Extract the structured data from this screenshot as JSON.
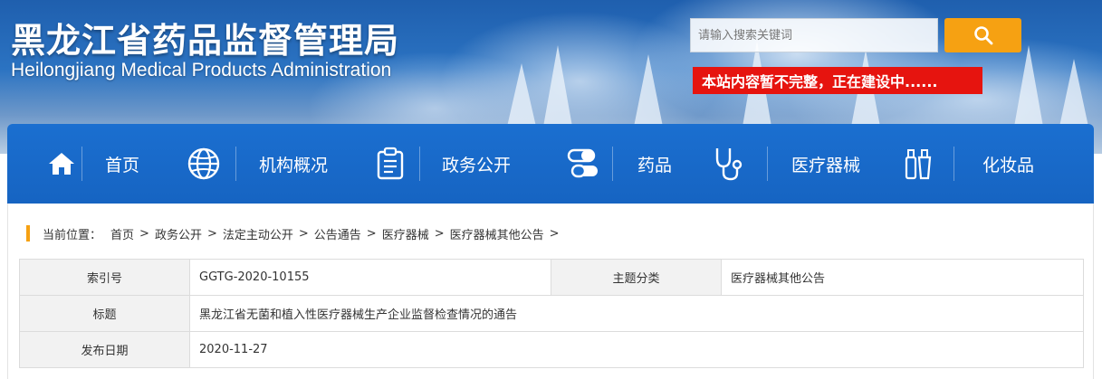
{
  "header": {
    "title": "黑龙江省药品监督管理局",
    "subtitle": "Heilongjiang Medical Products Administration",
    "search_placeholder": "请输入搜索关键词",
    "notice": "本站内容暂不完整，正在建设中......"
  },
  "nav": {
    "items": [
      {
        "label": "首页",
        "icon": "home-icon"
      },
      {
        "label": "机构概况",
        "icon": "globe-icon"
      },
      {
        "label": "政务公开",
        "icon": "clipboard-icon"
      },
      {
        "label": "药品",
        "icon": "pill-icon"
      },
      {
        "label": "医疗器械",
        "icon": "stethoscope-icon"
      },
      {
        "label": "化妆品",
        "icon": "cosmetics-icon"
      }
    ]
  },
  "breadcrumb": {
    "prefix": "当前位置：",
    "items": [
      "首页",
      "政务公开",
      "法定主动公开",
      "公告通告",
      "医疗器械",
      "医疗器械其他公告"
    ],
    "separator": ">"
  },
  "meta": {
    "index_label": "索引号",
    "index_value": "GGTG-2020-10155",
    "category_label": "主题分类",
    "category_value": "医疗器械其他公告",
    "title_label": "标题",
    "title_value": "黑龙江省无菌和植入性医疗器械生产企业监督检查情况的通告",
    "date_label": "发布日期",
    "date_value": "2020-11-27"
  },
  "colors": {
    "nav_bg": "#1b6fd0",
    "accent": "#f6a112",
    "notice_bg": "#e6140f"
  }
}
